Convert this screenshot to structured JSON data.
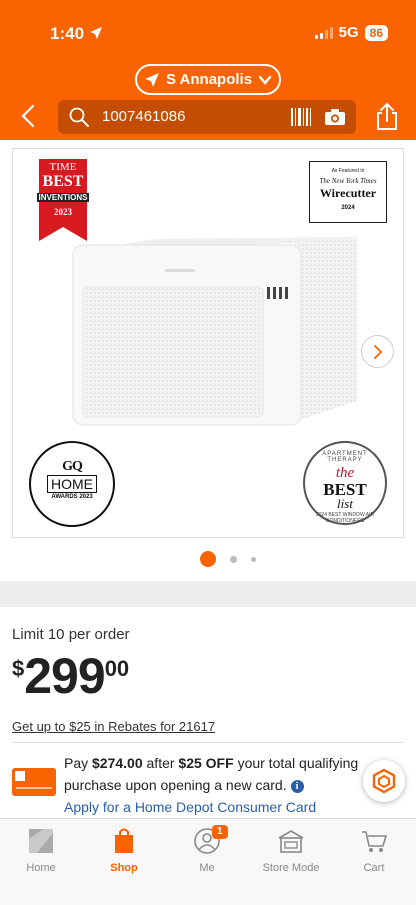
{
  "status_bar": {
    "time": "1:40",
    "network": "5G",
    "battery": "86"
  },
  "header": {
    "store_name": "S Annapolis",
    "search_value": "1007461086",
    "brand_color": "#f96302"
  },
  "gallery": {
    "badges": {
      "time": {
        "top": "TIME",
        "best": "BEST",
        "inventions": "INVENTIONS",
        "year": "2023"
      },
      "wirecutter": {
        "featured": "As Featured In",
        "nyt": "The New York Times",
        "name": "Wirecutter",
        "year": "2024"
      },
      "gq": {
        "logo": "GQ",
        "home": "HOME",
        "awards": "AWARDS 2023"
      },
      "apartment_therapy": {
        "top": "APARTMENT THERAPY",
        "the": "the",
        "best": "BEST",
        "list": "list",
        "bottom": "2024 BEST WINDOW AIR CONDITIONERS"
      }
    },
    "current_slide": 1,
    "total_dots": 3
  },
  "product": {
    "limit_text": "Limit 10 per order",
    "price_symbol": "$",
    "price_dollars": "299",
    "price_cents": "00",
    "rebate_link": "Get up to $25 in Rebates for 21617"
  },
  "card_offer": {
    "pay_prefix": "Pay",
    "pay_amount": "$274.00",
    "after": "after",
    "off_amount": "$25 OFF",
    "rest": "your total qualifying purchase upon opening a new card.",
    "apply_link": "Apply for a Home Depot Consumer Card"
  },
  "bottom_nav": {
    "items": [
      {
        "label": "Home",
        "icon": "home-depot-logo-icon"
      },
      {
        "label": "Shop",
        "icon": "shopping-bag-icon",
        "active": true
      },
      {
        "label": "Me",
        "icon": "user-icon",
        "badge": "1"
      },
      {
        "label": "Store Mode",
        "icon": "store-icon"
      },
      {
        "label": "Cart",
        "icon": "cart-icon"
      }
    ]
  }
}
